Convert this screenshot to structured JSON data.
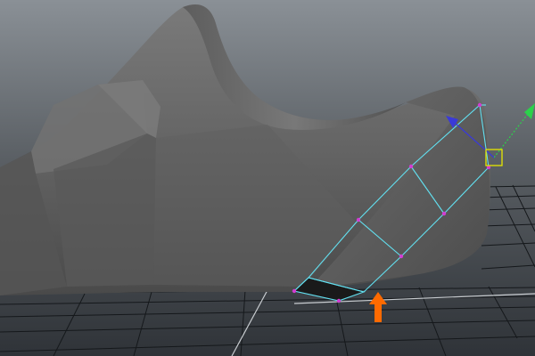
{
  "viewport": {
    "background_top": "#8a9096",
    "background_bottom": "#2f3338",
    "grid_color": "#101214",
    "grid_highlight": "#c8ccd0"
  },
  "model": {
    "shade_light": "#6f6f6f",
    "shade_mid": "#5d5d5d",
    "shade_dark": "#3e3e3e",
    "shade_facet": "#767676"
  },
  "selection": {
    "edge_color": "#62e0f0",
    "vertex_color": "#d23cd2",
    "selected_face_color": "#1a1a1a"
  },
  "manipulator": {
    "handle_color": "#e6e600",
    "axis_y_color": "#2bd24a",
    "axis_z_color": "#3a3ad8"
  },
  "annotation": {
    "arrow_color": "#ff6a00",
    "arrow_icon": "up-arrow-icon"
  }
}
